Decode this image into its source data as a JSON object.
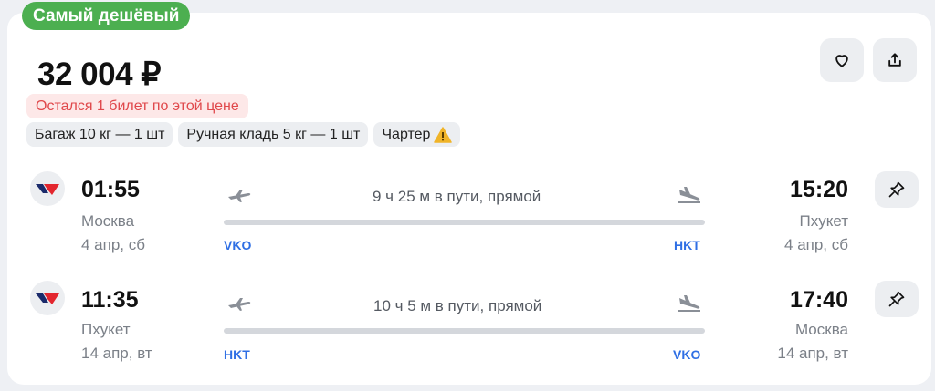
{
  "offer": {
    "badge": "Самый дешёвый",
    "price": "32 004 ₽",
    "warning": "Остался 1 билет по этой цене",
    "tags": [
      "Багаж 10 кг — 1 шт",
      "Ручная кладь 5 кг — 1 шт",
      "Чартер"
    ],
    "like_icon": "heart-icon",
    "share_icon": "share-icon"
  },
  "segments": [
    {
      "depart_time": "01:55",
      "depart_city": "Москва",
      "depart_date": "4 апр, сб",
      "depart_iata": "VKO",
      "duration": "9 ч 25 м в пути, прямой",
      "arrive_time": "15:20",
      "arrive_city": "Пхукет",
      "arrive_date": "4 апр, сб",
      "arrive_iata": "HKT"
    },
    {
      "depart_time": "11:35",
      "depart_city": "Пхукет",
      "depart_date": "14 апр, вт",
      "depart_iata": "HKT",
      "duration": "10 ч 5 м в пути, прямой",
      "arrive_time": "17:40",
      "arrive_city": "Москва",
      "arrive_date": "14 апр, вт",
      "arrive_iata": "VKO"
    }
  ],
  "colors": {
    "badge": "#4caf50",
    "warning_text": "#e0484b",
    "iata": "#2f6fe4"
  }
}
